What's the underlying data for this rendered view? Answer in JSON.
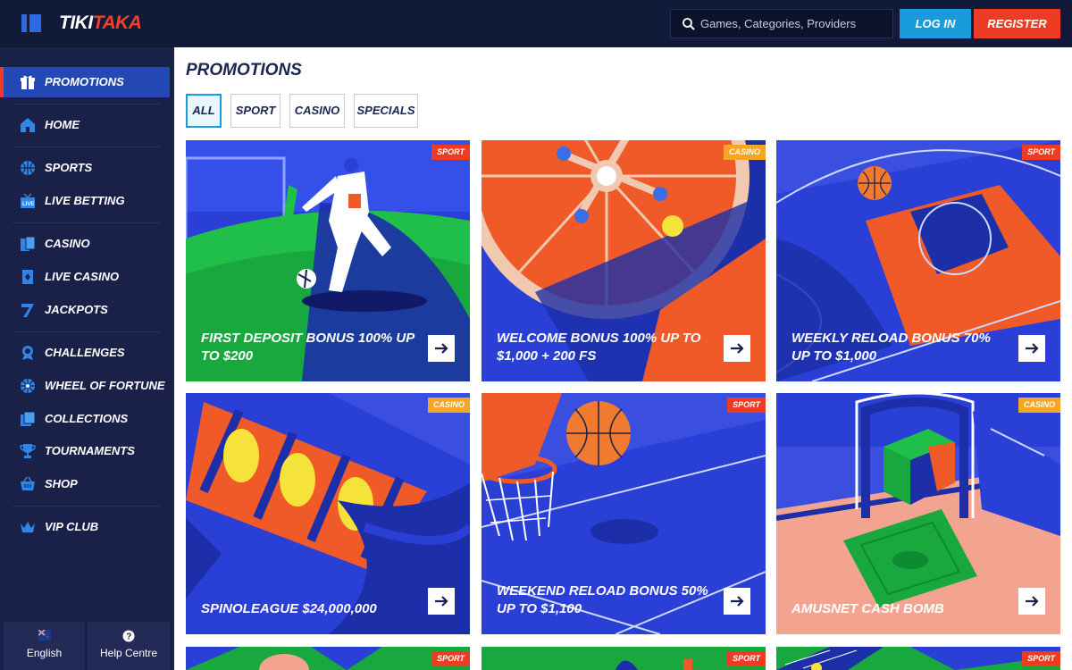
{
  "header": {
    "logo_part1": "TIKI",
    "logo_part2": "TAKA",
    "search_placeholder": "Games, Categories, Providers",
    "login_label": "LOG IN",
    "register_label": "REGISTER"
  },
  "sidebar": {
    "items": [
      {
        "label": "PROMOTIONS",
        "icon": "gift-icon"
      },
      {
        "label": "HOME",
        "icon": "home-icon"
      },
      {
        "label": "SPORTS",
        "icon": "basketball-icon"
      },
      {
        "label": "LIVE BETTING",
        "icon": "live-tv-icon"
      },
      {
        "label": "CASINO",
        "icon": "cards-icon"
      },
      {
        "label": "LIVE CASINO",
        "icon": "live-casino-icon"
      },
      {
        "label": "JACKPOTS",
        "icon": "seven-icon"
      },
      {
        "label": "CHALLENGES",
        "icon": "medal-icon"
      },
      {
        "label": "WHEEL OF FORTUNE",
        "icon": "wheel-icon"
      },
      {
        "label": "COLLECTIONS",
        "icon": "collections-icon"
      },
      {
        "label": "TOURNAMENTS",
        "icon": "trophy-icon"
      },
      {
        "label": "SHOP",
        "icon": "basket-icon"
      },
      {
        "label": "VIP CLUB",
        "icon": "crown-icon"
      }
    ],
    "footer": {
      "language_label": "English",
      "help_label": "Help Centre"
    }
  },
  "main": {
    "title": "PROMOTIONS",
    "tabs": [
      "ALL",
      "SPORT",
      "CASINO",
      "SPECIALS"
    ],
    "cards": [
      {
        "title": "FIRST DEPOSIT BONUS 100% UP TO $200",
        "badge": "SPORT"
      },
      {
        "title": "WELCOME BONUS 100% UP TO $1,000 + 200 FS",
        "badge": "CASINO"
      },
      {
        "title": "WEEKLY RELOAD BONUS 70% UP TO $1,000",
        "badge": "SPORT"
      },
      {
        "title": "SPINOLEAGUE $24,000,000",
        "badge": "CASINO"
      },
      {
        "title": "WEEKEND RELOAD BONUS 50% UP TO $1,100",
        "badge": "SPORT"
      },
      {
        "title": "AMUSNET CASH BOMB",
        "badge": "CASINO"
      },
      {
        "badge": "SPORT"
      },
      {
        "badge": "SPORT"
      },
      {
        "badge": "SPORT"
      }
    ]
  },
  "colors": {
    "header_bg": "#121a3a",
    "sidebar_bg": "#1a2148",
    "accent_blue": "#1a9bdc",
    "accent_red": "#ee3c24",
    "badge_casino": "#f5a623"
  }
}
